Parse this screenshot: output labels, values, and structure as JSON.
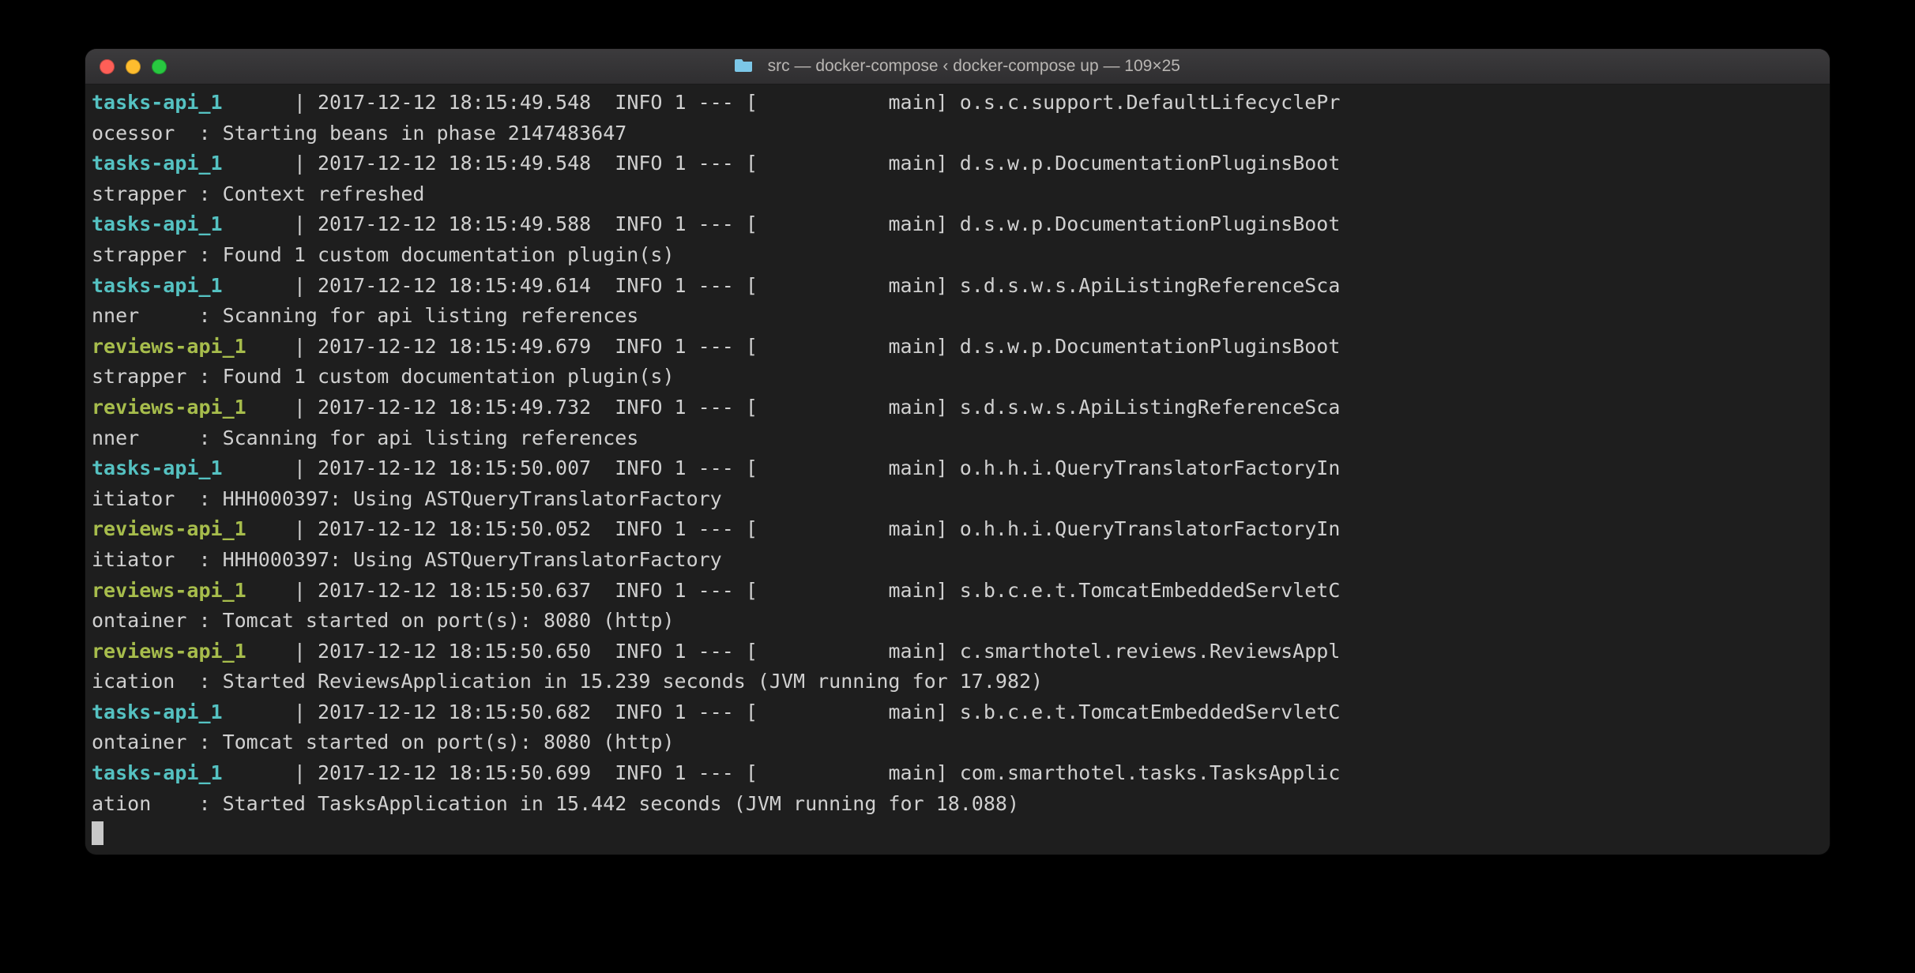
{
  "window": {
    "title": "src — docker-compose ‹ docker-compose up — 109×25"
  },
  "services": {
    "tasks": "tasks-api_1",
    "reviews": "reviews-api_1"
  },
  "lines": [
    {
      "svc": "tasks",
      "pad": "      ",
      "text": "2017-12-12 18:15:49.548  INFO 1 --- [           main] o.s.c.support.DefaultLifecyclePr"
    },
    {
      "cont": "ocessor  : Starting beans in phase 2147483647"
    },
    {
      "svc": "tasks",
      "pad": "      ",
      "text": "2017-12-12 18:15:49.548  INFO 1 --- [           main] d.s.w.p.DocumentationPluginsBoot"
    },
    {
      "cont": "strapper : Context refreshed"
    },
    {
      "svc": "tasks",
      "pad": "      ",
      "text": "2017-12-12 18:15:49.588  INFO 1 --- [           main] d.s.w.p.DocumentationPluginsBoot"
    },
    {
      "cont": "strapper : Found 1 custom documentation plugin(s)"
    },
    {
      "svc": "tasks",
      "pad": "      ",
      "text": "2017-12-12 18:15:49.614  INFO 1 --- [           main] s.d.s.w.s.ApiListingReferenceSca"
    },
    {
      "cont": "nner     : Scanning for api listing references"
    },
    {
      "svc": "reviews",
      "pad": "    ",
      "text": "2017-12-12 18:15:49.679  INFO 1 --- [           main] d.s.w.p.DocumentationPluginsBoot"
    },
    {
      "cont": "strapper : Found 1 custom documentation plugin(s)"
    },
    {
      "svc": "reviews",
      "pad": "    ",
      "text": "2017-12-12 18:15:49.732  INFO 1 --- [           main] s.d.s.w.s.ApiListingReferenceSca"
    },
    {
      "cont": "nner     : Scanning for api listing references"
    },
    {
      "svc": "tasks",
      "pad": "      ",
      "text": "2017-12-12 18:15:50.007  INFO 1 --- [           main] o.h.h.i.QueryTranslatorFactoryIn"
    },
    {
      "cont": "itiator  : HHH000397: Using ASTQueryTranslatorFactory"
    },
    {
      "svc": "reviews",
      "pad": "    ",
      "text": "2017-12-12 18:15:50.052  INFO 1 --- [           main] o.h.h.i.QueryTranslatorFactoryIn"
    },
    {
      "cont": "itiator  : HHH000397: Using ASTQueryTranslatorFactory"
    },
    {
      "svc": "reviews",
      "pad": "    ",
      "text": "2017-12-12 18:15:50.637  INFO 1 --- [           main] s.b.c.e.t.TomcatEmbeddedServletC"
    },
    {
      "cont": "ontainer : Tomcat started on port(s): 8080 (http)"
    },
    {
      "svc": "reviews",
      "pad": "    ",
      "text": "2017-12-12 18:15:50.650  INFO 1 --- [           main] c.smarthotel.reviews.ReviewsAppl"
    },
    {
      "cont": "ication  : Started ReviewsApplication in 15.239 seconds (JVM running for 17.982)"
    },
    {
      "svc": "tasks",
      "pad": "      ",
      "text": "2017-12-12 18:15:50.682  INFO 1 --- [           main] s.b.c.e.t.TomcatEmbeddedServletC"
    },
    {
      "cont": "ontainer : Tomcat started on port(s): 8080 (http)"
    },
    {
      "svc": "tasks",
      "pad": "      ",
      "text": "2017-12-12 18:15:50.699  INFO 1 --- [           main] com.smarthotel.tasks.TasksApplic"
    },
    {
      "cont": "ation    : Started TasksApplication in 15.442 seconds (JVM running for 18.088)"
    }
  ]
}
